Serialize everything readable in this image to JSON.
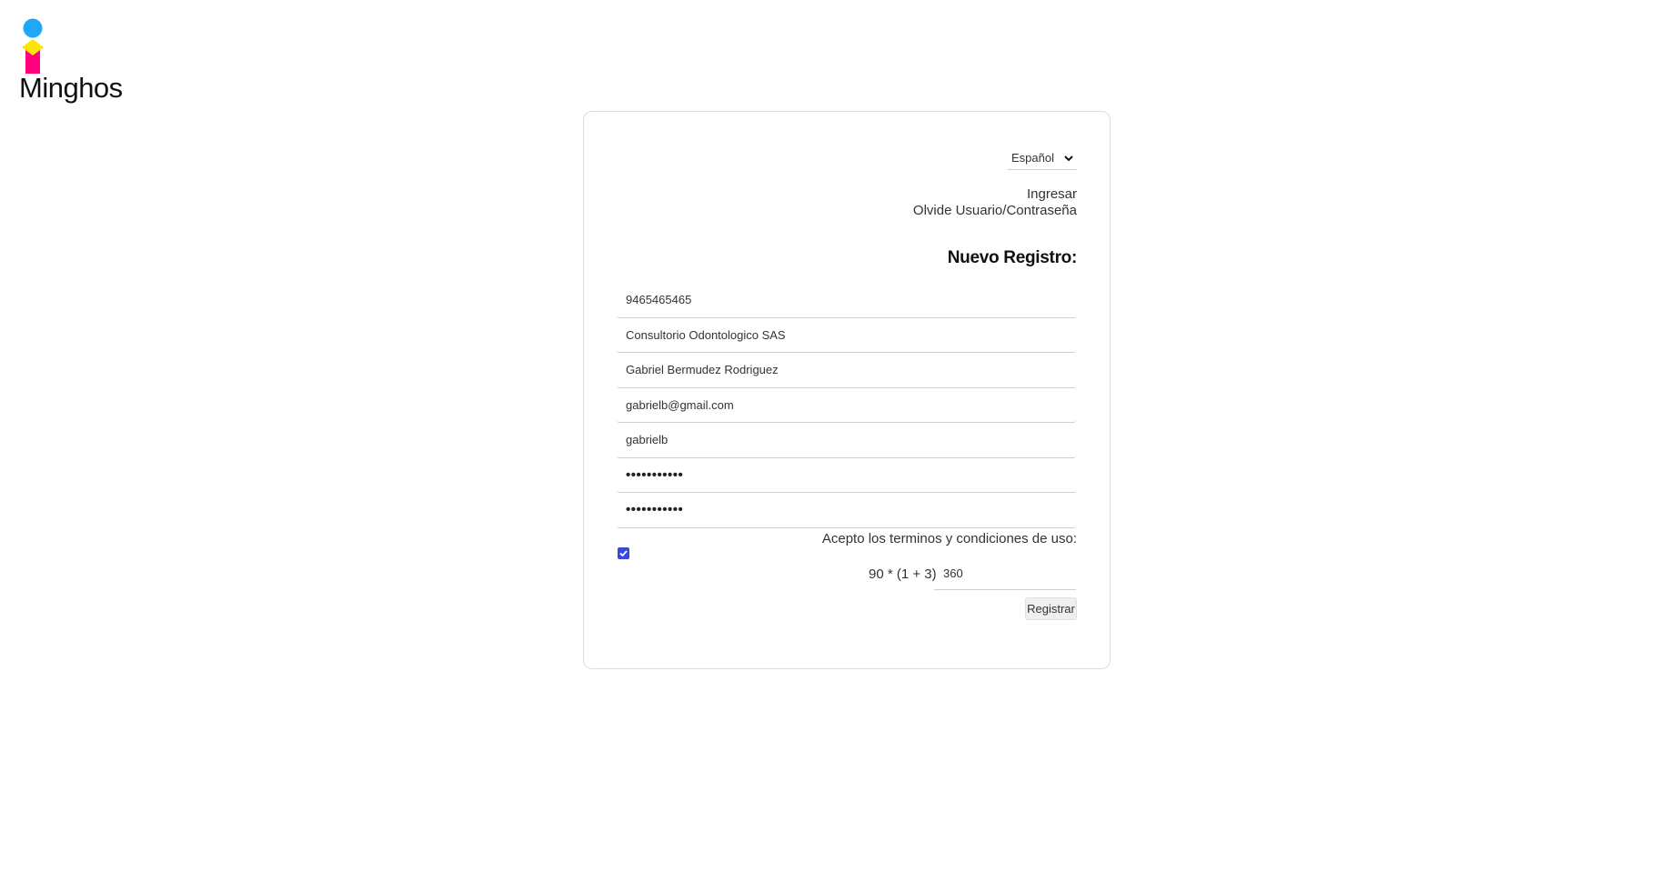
{
  "brand": {
    "name": "Minghos",
    "colors": {
      "circle": "#1fa8f5",
      "diamond": "#ffe600",
      "base": "#ff007f"
    }
  },
  "language": {
    "selected": "Español",
    "icon": "chevron-down-icon"
  },
  "links": {
    "login": "Ingresar",
    "forgot": "Olvide Usuario/Contraseña"
  },
  "form": {
    "title": "Nuevo Registro:",
    "fields": [
      {
        "value": "9465465465",
        "type": "text"
      },
      {
        "value": "Consultorio Odontologico SAS",
        "type": "text"
      },
      {
        "value": "Gabriel Bermudez Rodriguez",
        "type": "text"
      },
      {
        "value": "gabrielb@gmail.com",
        "type": "text"
      },
      {
        "value": "gabrielb",
        "type": "text"
      },
      {
        "value": "•••••••••••",
        "type": "password"
      },
      {
        "value": "•••••••••••",
        "type": "password"
      }
    ],
    "terms_label": "Acepto los terminos y condiciones de uso:",
    "terms_checked": true,
    "captcha_question": "90 * (1 + 3)",
    "captcha_answer": "360",
    "submit_label": "Registrar"
  },
  "accent_color": "#3b48e0"
}
